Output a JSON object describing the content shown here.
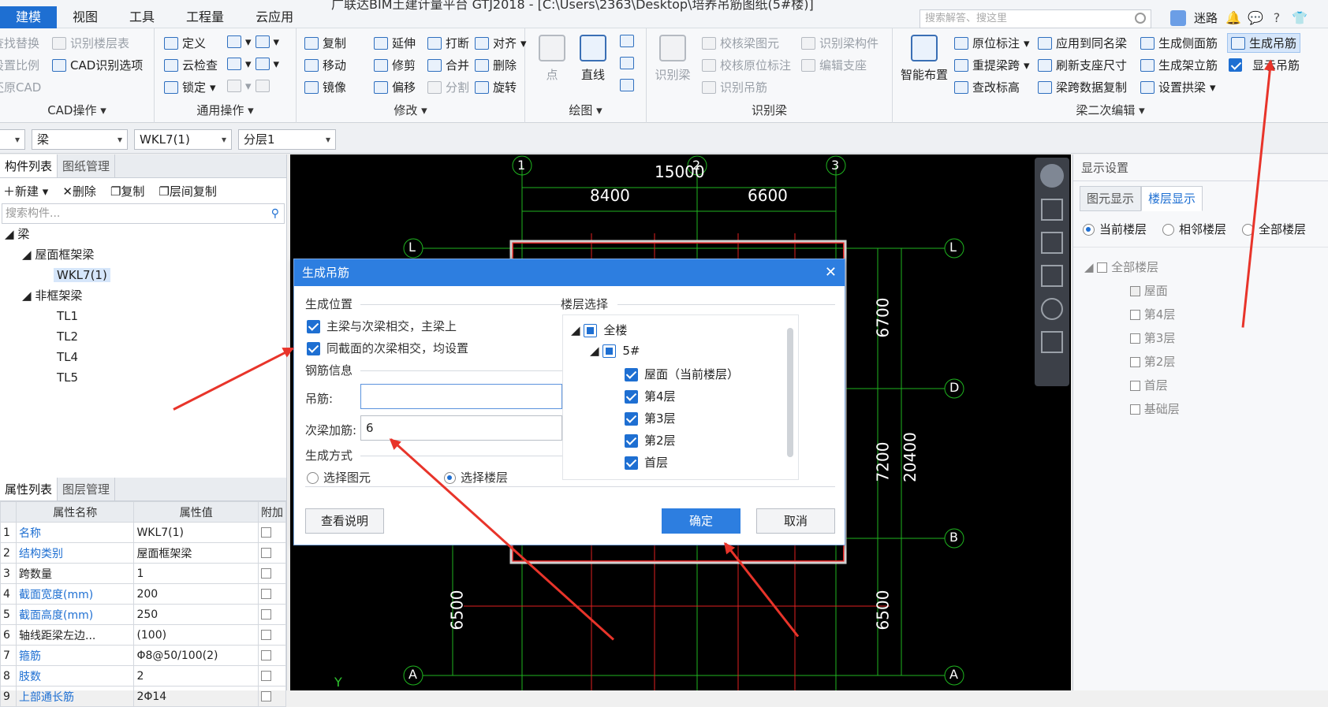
{
  "titlebar": {
    "tabs": [
      "建模",
      "视图",
      "工具",
      "工程量",
      "云应用"
    ],
    "active_tab": "建模",
    "title_text": "广联达BIM土建计量平台 GTJ2018 - [C:\\Users\\2363\\Desktop\\培养吊筋图纸(5#楼)]",
    "search_placeholder": "搜索解答、搜这里",
    "user_name": "迷路"
  },
  "ribbon": {
    "cad_group": {
      "label": "CAD操作",
      "items": [
        "查找替换",
        "识别楼层表",
        "设置比例",
        "CAD识别选项",
        "还原CAD"
      ]
    },
    "general_group": {
      "label": "通用操作",
      "items": [
        "定义",
        "云检查",
        "锁定"
      ]
    },
    "modify_group": {
      "label": "修改",
      "items": [
        "复制",
        "延伸",
        "打断",
        "对齐",
        "移动",
        "修剪",
        "合并",
        "删除",
        "镜像",
        "偏移",
        "分割",
        "旋转"
      ]
    },
    "draw_group": {
      "label": "绘图",
      "items": [
        "点",
        "直线"
      ]
    },
    "identify_group": {
      "label": "识别梁",
      "items": [
        "识别梁",
        "校核梁图元",
        "识别梁构件",
        "校核原位标注",
        "编辑支座",
        "识别吊筋"
      ]
    },
    "secondary_group": {
      "label": "梁二次编辑",
      "items": [
        "智能布置",
        "原位标注",
        "应用到同名梁",
        "生成侧面筋",
        "生成吊筋",
        "重提梁跨",
        "刷新支座尺寸",
        "生成架立筋",
        "显示吊筋",
        "查改标高",
        "梁跨数据复制",
        "设置拱梁"
      ]
    }
  },
  "filterbar": {
    "combo1": "",
    "combo2": "梁",
    "combo3": "WKL7(1)",
    "combo4": "分层1"
  },
  "left": {
    "component_tabs": [
      "构件列表",
      "图纸管理"
    ],
    "toolbar": [
      "新建",
      "删除",
      "复制",
      "层间复制"
    ],
    "search_placeholder": "搜索构件...",
    "tree": {
      "root": "梁",
      "group1": "屋面框架梁",
      "group1_items": [
        "WKL7(1)"
      ],
      "group2": "非框架梁",
      "group2_items": [
        "TL1",
        "TL2",
        "TL4",
        "TL5"
      ]
    },
    "property_tabs": [
      "属性列表",
      "图层管理"
    ],
    "property_headers": [
      "属性名称",
      "属性值",
      "附加"
    ],
    "properties": [
      {
        "no": "1",
        "name": "名称",
        "value": "WKL7(1)",
        "blue": true
      },
      {
        "no": "2",
        "name": "结构类别",
        "value": "屋面框架梁",
        "blue": true
      },
      {
        "no": "3",
        "name": "跨数量",
        "value": "1",
        "blue": false
      },
      {
        "no": "4",
        "name": "截面宽度(mm)",
        "value": "200",
        "blue": true
      },
      {
        "no": "5",
        "name": "截面高度(mm)",
        "value": "250",
        "blue": true
      },
      {
        "no": "6",
        "name": "轴线距梁左边...",
        "value": "(100)",
        "blue": false
      },
      {
        "no": "7",
        "name": "箍筋",
        "value": "Φ8@50/100(2)",
        "blue": true
      },
      {
        "no": "8",
        "name": "肢数",
        "value": "2",
        "blue": true
      },
      {
        "no": "9",
        "name": "上部通长筋",
        "value": "2Φ14",
        "blue": true
      }
    ]
  },
  "canvas": {
    "axis_top": [
      "1",
      "2",
      "3"
    ],
    "axis_side": [
      "L",
      "D",
      "B",
      "A"
    ],
    "dim_total": "15000",
    "dims_top": [
      "8400",
      "6600"
    ],
    "dims_right": [
      "6700",
      "7200",
      "20400",
      "6500"
    ],
    "dim_left": "6500",
    "y_axis": "Y"
  },
  "right": {
    "title": "显示设置",
    "tabs": [
      "图元显示",
      "楼层显示"
    ],
    "active_tab": "楼层显示",
    "radios": [
      "当前楼层",
      "相邻楼层",
      "全部楼层"
    ],
    "all_label": "全部楼层",
    "floors": [
      {
        "label": "屋面",
        "checked": true
      },
      {
        "label": "第4层",
        "checked": false
      },
      {
        "label": "第3层",
        "checked": false
      },
      {
        "label": "第2层",
        "checked": false
      },
      {
        "label": "首层",
        "checked": false
      },
      {
        "label": "基础层",
        "checked": false
      }
    ]
  },
  "dialog": {
    "title": "生成吊筋",
    "section_position": "生成位置",
    "opt1": "主梁与次梁相交，主梁上",
    "opt2": "同截面的次梁相交，均设置",
    "section_rebar": "钢筋信息",
    "hanger_label": "吊筋:",
    "hanger_value": "",
    "stirrup_label": "次梁加筋:",
    "stirrup_value": "6",
    "section_method": "生成方式",
    "method_options": [
      "选择图元",
      "选择楼层"
    ],
    "method_selected": "选择楼层",
    "section_floor": "楼层选择",
    "floor_tree": [
      "全楼",
      "5#",
      "屋面（当前楼层）",
      "第4层",
      "第3层",
      "第2层",
      "首层"
    ],
    "btn_help": "查看说明",
    "btn_ok": "确定",
    "btn_cancel": "取消"
  }
}
